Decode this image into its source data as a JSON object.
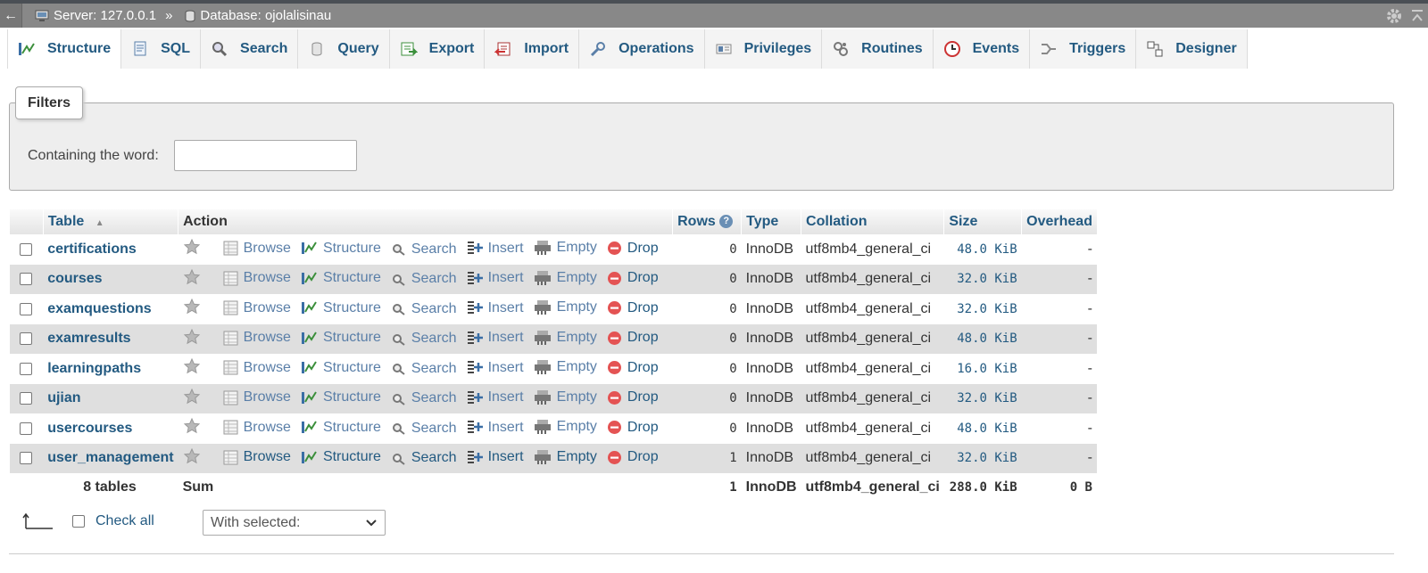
{
  "serverbar": {
    "back": "←",
    "server": "Server: 127.0.0.1",
    "sep": "»",
    "database": "Database: ojolalisinau"
  },
  "tabs": [
    {
      "label": "Structure",
      "icon": "structure-icon",
      "active": true
    },
    {
      "label": "SQL",
      "icon": "sql-icon"
    },
    {
      "label": "Search",
      "icon": "search-icon"
    },
    {
      "label": "Query",
      "icon": "query-icon"
    },
    {
      "label": "Export",
      "icon": "export-icon"
    },
    {
      "label": "Import",
      "icon": "import-icon"
    },
    {
      "label": "Operations",
      "icon": "wrench-icon"
    },
    {
      "label": "Privileges",
      "icon": "privileges-icon"
    },
    {
      "label": "Routines",
      "icon": "routines-icon"
    },
    {
      "label": "Events",
      "icon": "clock-icon"
    },
    {
      "label": "Triggers",
      "icon": "triggers-icon"
    },
    {
      "label": "Designer",
      "icon": "designer-icon"
    }
  ],
  "filters": {
    "legend": "Filters",
    "label": "Containing the word:",
    "value": ""
  },
  "table": {
    "headers": {
      "table": "Table",
      "sort": "▲",
      "action": "Action",
      "rows": "Rows",
      "type": "Type",
      "collation": "Collation",
      "size": "Size",
      "overhead": "Overhead"
    },
    "actions": {
      "browse": "Browse",
      "structure": "Structure",
      "search": "Search",
      "insert": "Insert",
      "empty": "Empty",
      "drop": "Drop"
    },
    "rows": [
      {
        "name": "certifications",
        "rows": "0",
        "type": "InnoDB",
        "collation": "utf8mb4_general_ci",
        "size": "48.0 KiB",
        "overhead": "-"
      },
      {
        "name": "courses",
        "rows": "0",
        "type": "InnoDB",
        "collation": "utf8mb4_general_ci",
        "size": "32.0 KiB",
        "overhead": "-"
      },
      {
        "name": "examquestions",
        "rows": "0",
        "type": "InnoDB",
        "collation": "utf8mb4_general_ci",
        "size": "32.0 KiB",
        "overhead": "-"
      },
      {
        "name": "examresults",
        "rows": "0",
        "type": "InnoDB",
        "collation": "utf8mb4_general_ci",
        "size": "48.0 KiB",
        "overhead": "-"
      },
      {
        "name": "learningpaths",
        "rows": "0",
        "type": "InnoDB",
        "collation": "utf8mb4_general_ci",
        "size": "16.0 KiB",
        "overhead": "-"
      },
      {
        "name": "ujian",
        "rows": "0",
        "type": "InnoDB",
        "collation": "utf8mb4_general_ci",
        "size": "32.0 KiB",
        "overhead": "-"
      },
      {
        "name": "usercourses",
        "rows": "0",
        "type": "InnoDB",
        "collation": "utf8mb4_general_ci",
        "size": "48.0 KiB",
        "overhead": "-"
      },
      {
        "name": "user_management",
        "rows": "1",
        "type": "InnoDB",
        "collation": "utf8mb4_general_ci",
        "size": "32.0 KiB",
        "overhead": "-"
      }
    ],
    "footer": {
      "count": "8 tables",
      "sum": "Sum",
      "rows": "1",
      "type": "InnoDB",
      "collation": "utf8mb4_general_ci",
      "size": "288.0 KiB",
      "overhead": "0 B"
    }
  },
  "bottom": {
    "check_all": "Check all",
    "with_selected": "With selected:"
  }
}
